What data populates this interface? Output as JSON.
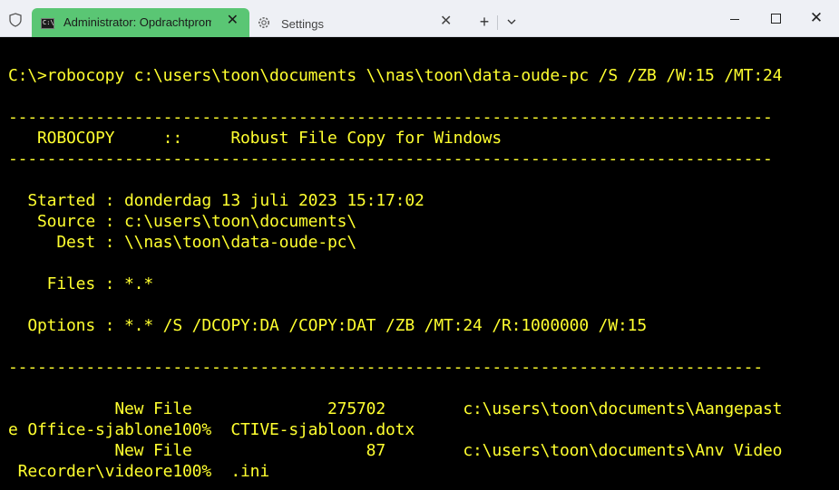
{
  "tabs": [
    {
      "title": "Administrator: Opdrachtprompt",
      "icon": "cmd-icon",
      "active": true
    },
    {
      "title": "Settings",
      "icon": "gear-icon",
      "active": false
    }
  ],
  "toolbar": {
    "new_tab": "+",
    "dropdown": "⌄"
  },
  "window_controls": {
    "close": "✕"
  },
  "colors": {
    "terminal_text": "#ffff2f",
    "terminal_bg": "#000000",
    "active_tab": "#5ac674",
    "titlebar": "#eef0f5"
  },
  "terminal": {
    "lines": [
      "",
      "C:\\>robocopy c:\\users\\toon\\documents \\\\nas\\toon\\data-oude-pc /S /ZB /W:15 /MT:24",
      "",
      "-------------------------------------------------------------------------------",
      "   ROBOCOPY     ::     Robust File Copy for Windows",
      "-------------------------------------------------------------------------------",
      "",
      "  Started : donderdag 13 juli 2023 15:17:02",
      "   Source : c:\\users\\toon\\documents\\",
      "     Dest : \\\\nas\\toon\\data-oude-pc\\",
      "",
      "    Files : *.*",
      "",
      "  Options : *.* /S /DCOPY:DA /COPY:DAT /ZB /MT:24 /R:1000000 /W:15",
      "",
      "------------------------------------------------------------------------------",
      "",
      "           New File              275702        c:\\users\\toon\\documents\\Aangepast",
      "e Office-sjablone100%  CTIVE-sjabloon.dotx",
      "           New File                  87        c:\\users\\toon\\documents\\Anv Video",
      " Recorder\\videore100%  .ini"
    ]
  }
}
